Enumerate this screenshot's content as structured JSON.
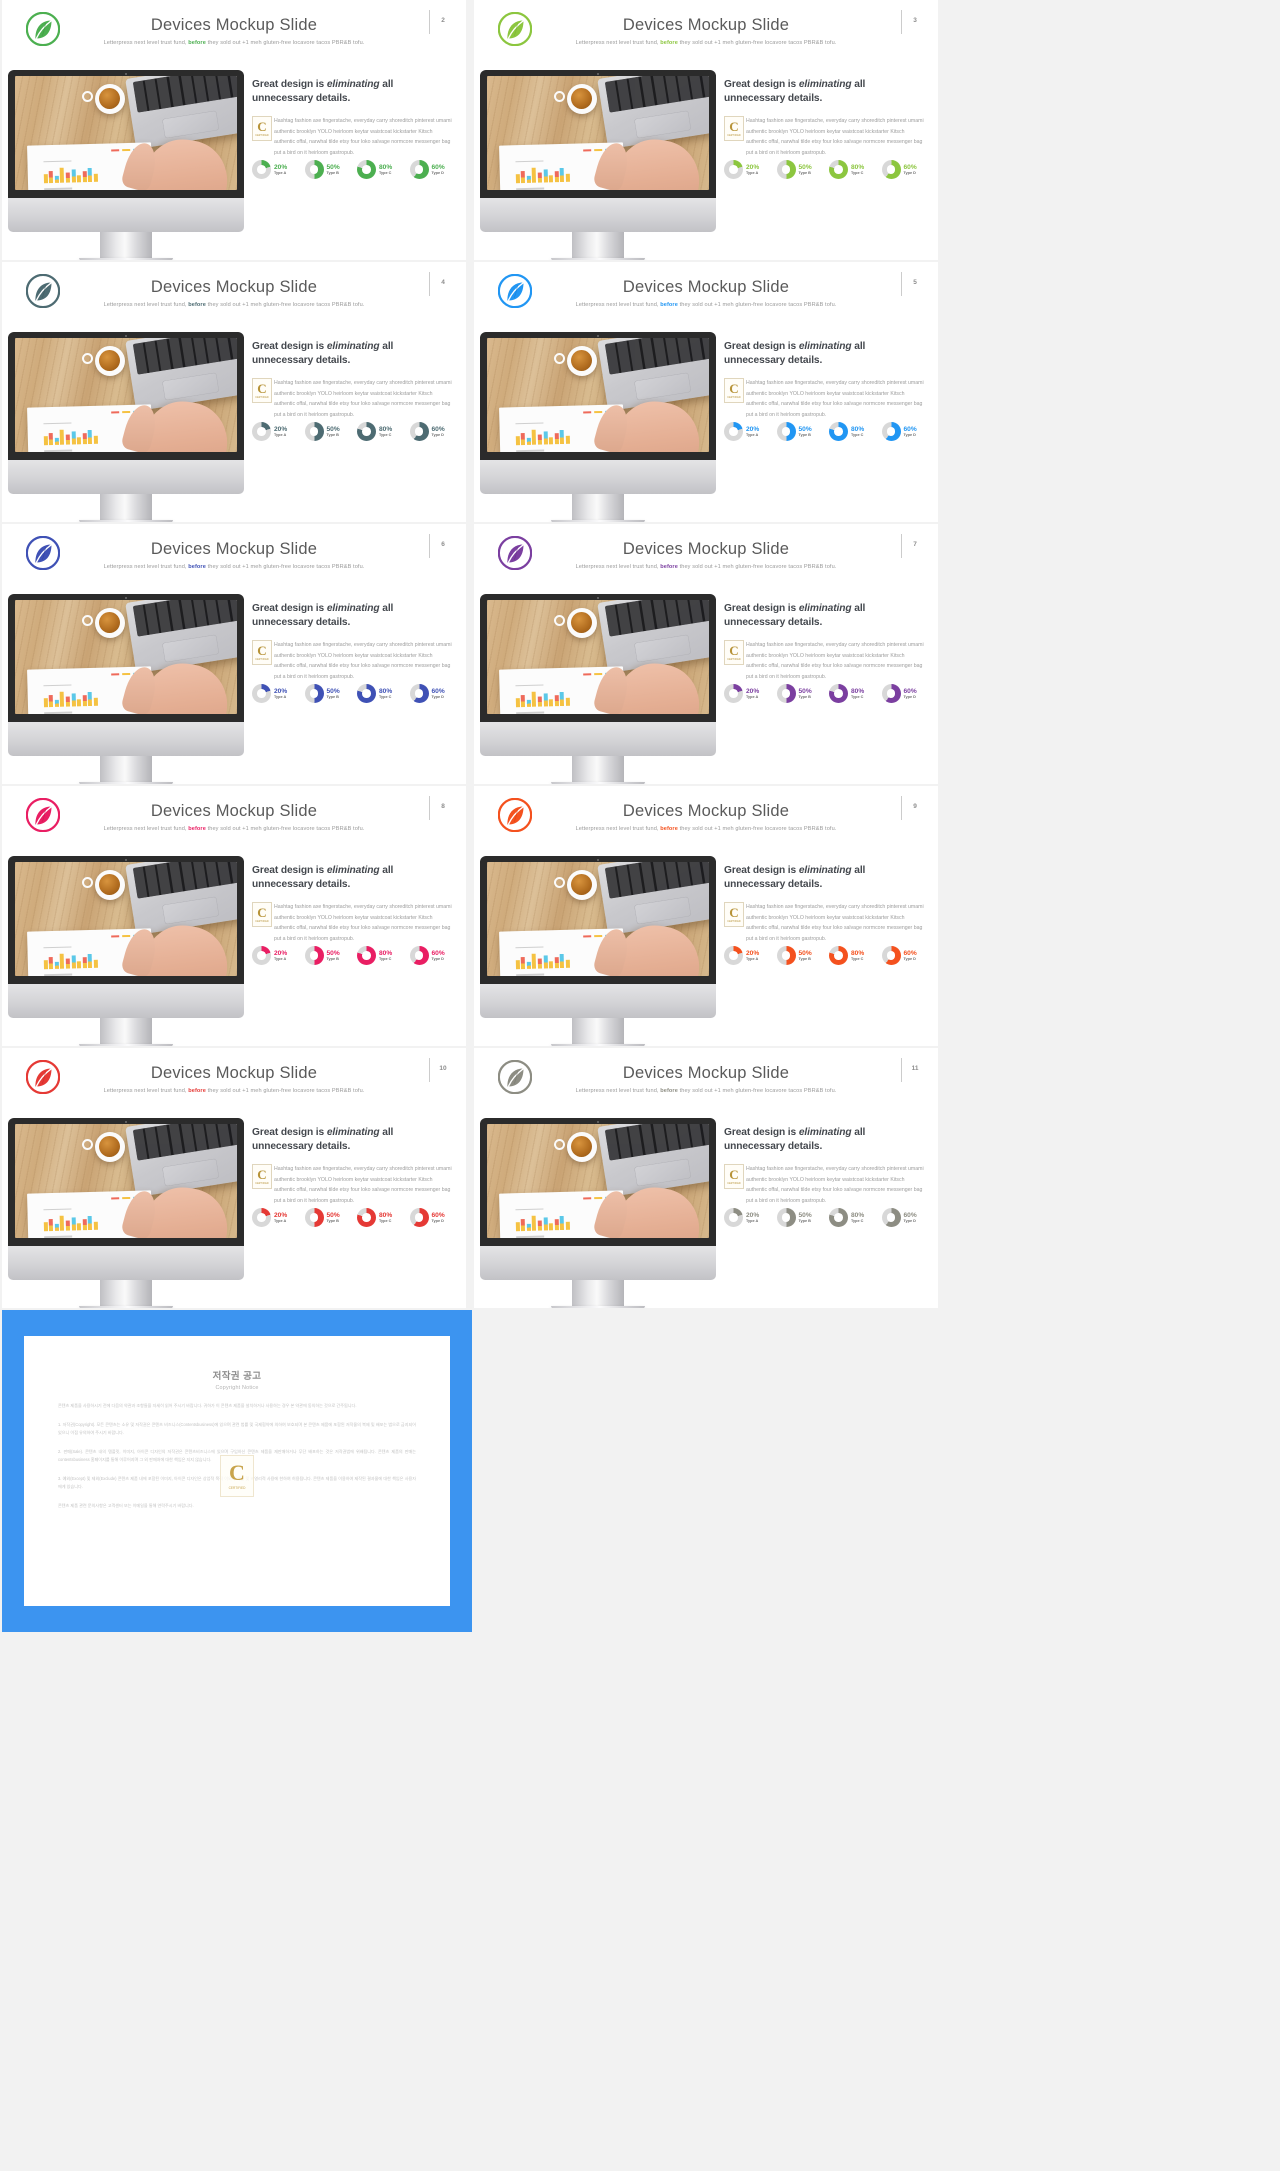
{
  "deck": {
    "slide_title": "Devices Mockup Slide",
    "subtitle_a": "Letterpress next level trust fund,",
    "subtitle_hl": "before",
    "subtitle_b": "they sold out +1 meh gluten-free locavore tacos PBR&B tofu.",
    "headline_a": "Great design is ",
    "headline_em": "eliminating",
    "headline_b": " all unnecessary details.",
    "paragraph_lines": [
      "Hashtag fashion axe fingerstache, everyday carry shoreditch pinterest umami",
      "authentic brooklyn YOLO heirloom keytar waistcoat kickstarter Kitsch",
      "authentic offal, narwhal tilde etsy four loko salvage normcore messenger bag",
      "put a bird on it heirloom gastropub."
    ],
    "badge": {
      "letter": "C",
      "caption": "CERTIFIED"
    },
    "donut_labels": [
      "Type A",
      "Type B",
      "Type C",
      "Type D"
    ],
    "donut_percents": [
      "20%",
      "50%",
      "80%",
      "60%"
    ],
    "donut_values": [
      20,
      50,
      80,
      60
    ],
    "track_color": "#d8d8d8"
  },
  "slides": [
    {
      "number": "2",
      "accent": "#4caf50",
      "accent_dark": "#3d9140",
      "logo": "leaf-logo-green"
    },
    {
      "number": "3",
      "accent": "#8cc63f",
      "accent_dark": "#76ad2e",
      "logo": "leaf-logo-lime"
    },
    {
      "number": "4",
      "accent": "#4d6b72",
      "accent_dark": "#3d565c",
      "logo": "leaf-logo-teal"
    },
    {
      "number": "5",
      "accent": "#2196f3",
      "accent_dark": "#1579cc",
      "logo": "leaf-logo-blue"
    },
    {
      "number": "6",
      "accent": "#3f51b5",
      "accent_dark": "#31409b",
      "logo": "leaf-logo-indigo"
    },
    {
      "number": "7",
      "accent": "#7b3fa0",
      "accent_dark": "#642f85",
      "logo": "leaf-logo-purple"
    },
    {
      "number": "8",
      "accent": "#e91e63",
      "accent_dark": "#c4154f",
      "logo": "leaf-logo-pink"
    },
    {
      "number": "9",
      "accent": "#f4511e",
      "accent_dark": "#d63f10",
      "logo": "leaf-logo-orange"
    },
    {
      "number": "10",
      "accent": "#e53935",
      "accent_dark": "#c62828",
      "logo": "leaf-logo-red"
    },
    {
      "number": "11",
      "accent": "#8d8d83",
      "accent_dark": "#76766d",
      "logo": "leaf-logo-gray"
    }
  ],
  "copyright": {
    "title": "저작권 공고",
    "subtitle": "Copyright Notice",
    "intro": "콘텐츠 제품을 사용하시기 전에 다음의 약관과 조항들을 자세히 읽어 주시기 바랍니다. 귀하가 이 콘텐츠 제품을 설치하거나 사용하는 경우 본 약관에 동의하는 것으로 간주됩니다.",
    "clause1": "1. 저작권(Copyright). 모든 콘텐츠는 소유 및 저작권은 콘텐츠 비즈니스(Contentsbusiness)에 있으며 관련 법률 및 국제협약에 의하여 보호되며 본 콘텐츠 제품에 포함된 저작물의 복제 및 배포는 법으로 금지되어 있으니 이점 유의하여 주시기 바랍니다.",
    "clause2": "2. 판매(Sale). 콘텐츠 내의 템플릿, 이미지, 아이콘 디자인의 저작권은 콘텐츠비즈니스에 있으며 구입하신 콘텐츠 제품을 재판매하거나 무단 배포하는 것은 저작권법에 위배됩니다. 콘텐츠 제품의 판매는 contentsbusiness 홈페이지를 통해 이루어지며 그 외 판매처에 대한 책임은 지지 않습니다.",
    "clause3": "3. 예외(Except) 및 제외(Exclude) 콘텐츠 제품 내에 포함된 이미지, 아이콘 디자인은 상업적 목적 이외의 개인 및 비영리적 사용에 한하여 허용됩니다. 콘텐츠 제품을 이용하여 제작된 결과물에 대한 책임은 사용자에게 있습니다.",
    "outro": "콘텐츠 제품 관련 문의사항은 고객센터 또는 이메일을 통해 연락주시기 바랍니다.",
    "watermark": {
      "letter": "C",
      "caption": "CERTIFIED"
    }
  }
}
